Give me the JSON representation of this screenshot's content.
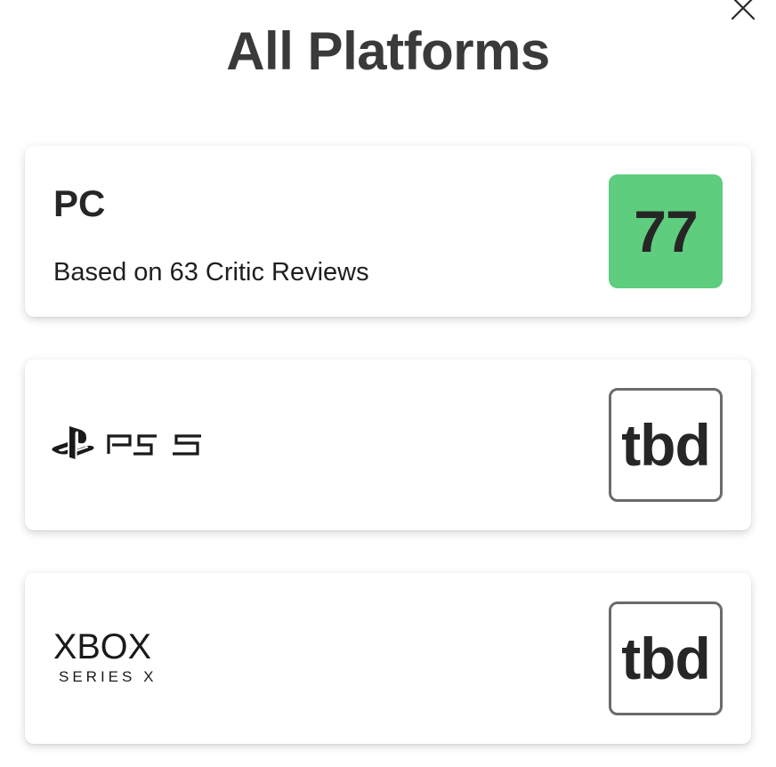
{
  "header": {
    "title": "All Platforms",
    "close_icon": "close-icon"
  },
  "platforms": [
    {
      "name": "PC",
      "reviews_text": "Based on 63 Critic Reviews",
      "score": "77",
      "score_color": "#5ecd7e"
    },
    {
      "name": "PS5",
      "logo_icon": "playstation-5-logo",
      "score": "tbd"
    },
    {
      "name": "XBOX SERIES X",
      "logo_icon": "xbox-series-x-logo",
      "logo_line1": "XBOX",
      "logo_line2": "SERIES X",
      "score": "tbd"
    }
  ]
}
